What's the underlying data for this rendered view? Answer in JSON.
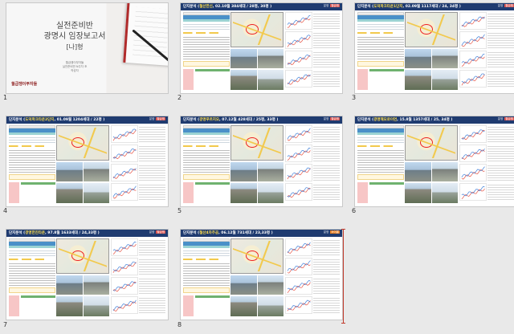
{
  "slides": [
    {
      "num": "1",
      "kind": "title",
      "title_line1": "실전준비반",
      "title_line2": "광명시 임장보고서",
      "title_line3": "[나]형",
      "subtitle_lines": [
        "월급쟁이부자들",
        "실전준비반 N주차 조",
        "작성자"
      ],
      "brand": "월급쟁이부자들"
    },
    {
      "num": "2",
      "kind": "report",
      "header_prefix": "단지분석 (",
      "header_name": "철산한신",
      "header_detail": ", 02.10월 384세대 / 28평, 30평 )",
      "tag_label": "분양",
      "tag_name": "월급쟁"
    },
    {
      "num": "3",
      "kind": "report",
      "header_prefix": "단지분석 (",
      "header_name": "도덕파크타운1단지",
      "header_detail": ", 02.09월 1117세대 / 24, 34평 )",
      "tag_label": "분양",
      "tag_name": "월급쟁"
    },
    {
      "num": "4",
      "kind": "report",
      "header_prefix": "단지분석 (",
      "header_name": "도덕파크타운2단지",
      "header_detail": ", 01.09월 1204세대 / 22평 )",
      "tag_label": "분양",
      "tag_name": "월급쟁"
    },
    {
      "num": "5",
      "kind": "report",
      "header_prefix": "단지분석 (",
      "header_name": "광명푸르지오",
      "header_detail": ", 07.12월 428세대 / 25평, 33평 )",
      "tag_label": "분양",
      "tag_name": "월급쟁"
    },
    {
      "num": "6",
      "kind": "report",
      "header_prefix": "단지분석 (",
      "header_name": "광명해모로이연",
      "header_detail": ", 15.8월 1357세대 / 25, 34평 )",
      "tag_label": "분양",
      "tag_name": "월급쟁"
    },
    {
      "num": "7",
      "kind": "report",
      "header_prefix": "단지분석 (",
      "header_name": "광명한진타운",
      "header_detail": ", 97.8월 1633세대 / 24,33평 )",
      "tag_label": "분양",
      "tag_name": "월급쟁"
    },
    {
      "num": "8",
      "kind": "report",
      "header_prefix": "단지분석 (",
      "header_name": "철산4차주공",
      "header_detail": ", 06.12월 731세대 / 23,33평 )",
      "tag_label": "분양",
      "tag_name": "소이롱"
    }
  ],
  "colors": {
    "header": "#1f3b70",
    "highlight": "#ffde4a",
    "selection_marker": "#c0392b"
  }
}
